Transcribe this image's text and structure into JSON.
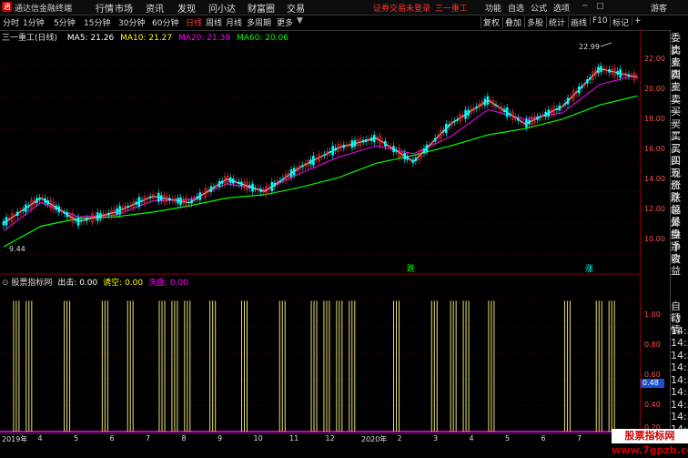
{
  "app": {
    "title": "通达信金融终端",
    "notice": "证券交易未登录",
    "stock_name": "三一重工"
  },
  "menu": [
    "行情",
    "市场",
    "资讯",
    "发现",
    "问小达",
    "财富圈",
    "交易"
  ],
  "top_right": [
    "功能",
    "自选",
    "公式",
    "选项",
    "游客"
  ],
  "periods": [
    "分时",
    "1分钟",
    "5分钟",
    "15分钟",
    "30分钟",
    "60分钟",
    "日线",
    "周线",
    "月线",
    "多周期",
    "更多"
  ],
  "active_period": "日线",
  "toolbar_right": [
    "复权",
    "叠加",
    "多股",
    "统计",
    "画线",
    "F10",
    "标记",
    "+"
  ],
  "ma_header": {
    "name": "三一重工(日线)",
    "items": [
      {
        "label": "MA5: 21.26",
        "color": "#ffffff"
      },
      {
        "label": "MA10: 21.27",
        "color": "#ffff00"
      },
      {
        "label": "MA20: 21.39",
        "color": "#ff00ff"
      },
      {
        "label": "MA60: 20.06",
        "color": "#00ff00"
      }
    ]
  },
  "indicator_header": {
    "name": "股票指标网",
    "items": [
      {
        "label": "出击: 0.00",
        "color": "#ffffff"
      },
      {
        "label": "诱空: 0.00",
        "color": "#ffff00"
      },
      {
        "label": "洗盘: 0.00",
        "color": "#ff00ff"
      }
    ]
  },
  "price_axis": [
    "22.00",
    "20.00",
    "18.00",
    "16.00",
    "14.00",
    "12.00",
    "10.00"
  ],
  "indicator_axis": [
    "1.00",
    "0.80",
    "0.60",
    "0.40",
    "0.20"
  ],
  "indicator_cursor_value": "0.48",
  "annotations": {
    "high": "22.99",
    "low": "9.44",
    "markers": [
      "跌",
      "涨"
    ]
  },
  "right_panel": [
    "委比",
    "卖五",
    "卖四",
    "卖三",
    "卖二",
    "卖一",
    "买一",
    "买二",
    "买三",
    "买四",
    "买五",
    "现价",
    "涨跌",
    "涨幅",
    "总量",
    "外盘",
    "换手",
    "净资",
    "收益",
    "自动",
    "行情",
    "14:5",
    "14:5",
    "14:5",
    "14:5",
    "14:5",
    "14:5",
    "14:5",
    "14:5",
    "14:5"
  ],
  "date_axis": [
    "2019年",
    "4",
    "5",
    "6",
    "7",
    "8",
    "9",
    "10",
    "11",
    "12",
    "2020年",
    "2",
    "3",
    "4",
    "5",
    "6",
    "7",
    "8"
  ],
  "watermark": "股票指标网 www.7gpzb.com",
  "colors": {
    "rise": "#ff3030",
    "fall": "#00ffff",
    "ma5": "#ffffff",
    "ma10": "#ffff00",
    "ma20": "#ff00ff",
    "ma60": "#00ff00",
    "signal": "#e8e070"
  },
  "chart_data": {
    "type": "line",
    "title": "三一重工(日线)",
    "x": [
      "2019-03",
      "2019-04",
      "2019-05",
      "2019-06",
      "2019-07",
      "2019-08",
      "2019-09",
      "2019-10",
      "2019-11",
      "2019-12",
      "2020-01",
      "2020-02",
      "2020-03",
      "2020-04",
      "2020-05",
      "2020-06",
      "2020-07",
      "2020-08"
    ],
    "series": [
      {
        "name": "MA60",
        "values": [
          10.5,
          11.8,
          12.3,
          12.4,
          12.7,
          13.1,
          13.6,
          13.8,
          14.3,
          14.9,
          15.8,
          16.3,
          16.9,
          17.6,
          18.0,
          18.6,
          19.5,
          20.06
        ]
      },
      {
        "name": "MA20",
        "values": [
          11.5,
          13.3,
          12.4,
          12.5,
          13.4,
          13.5,
          14.5,
          14.1,
          15.2,
          16.2,
          16.9,
          16.4,
          17.5,
          19.2,
          18.6,
          19.0,
          20.8,
          21.39
        ]
      },
      {
        "name": "MA5",
        "values": [
          12.0,
          13.6,
          12.1,
          12.7,
          13.7,
          13.3,
          14.8,
          14.0,
          15.6,
          16.8,
          17.4,
          15.9,
          18.3,
          19.8,
          18.3,
          19.4,
          21.8,
          21.26
        ]
      }
    ],
    "signals": [
      0.02,
      0.04,
      0.1,
      0.16,
      0.2,
      0.25,
      0.27,
      0.29,
      0.33,
      0.38,
      0.44,
      0.49,
      0.51,
      0.53,
      0.55,
      0.62,
      0.68,
      0.71,
      0.73,
      0.77,
      0.89,
      0.94,
      0.96
    ],
    "signal_value": 1.0,
    "ylim": [
      9.0,
      23.5
    ],
    "indicator_ylim": [
      0,
      1.1
    ],
    "annotations": [
      {
        "label": "22.99",
        "type": "high"
      },
      {
        "label": "9.44",
        "type": "low"
      }
    ]
  }
}
